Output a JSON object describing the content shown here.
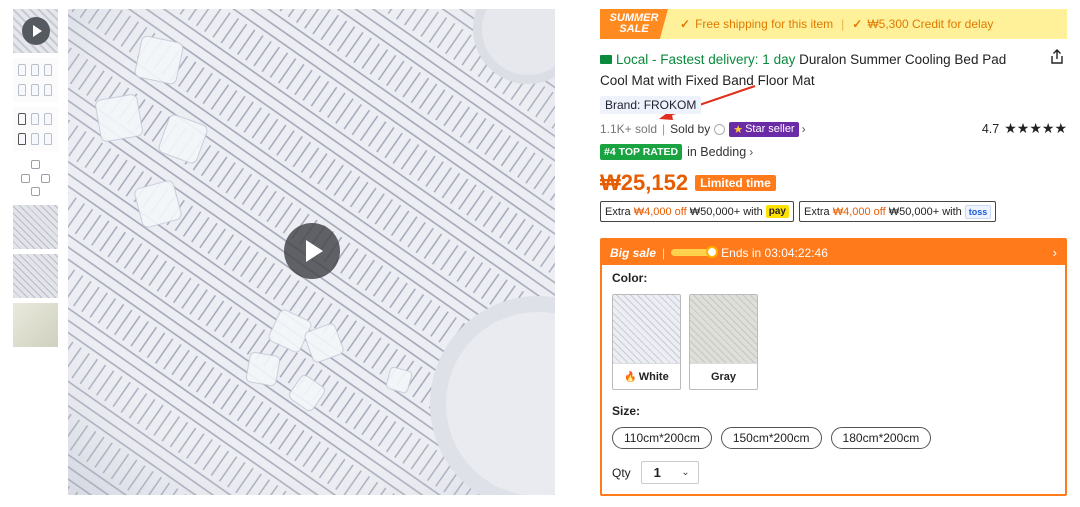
{
  "promo": {
    "badge_line1": "SUMMER",
    "badge_line2": "SALE",
    "free_shipping": "Free shipping for this item",
    "credit": "₩5,300 Credit for delay"
  },
  "product": {
    "delivery": "Local - Fastest delivery: 1 day",
    "title": "Duralon Summer Cooling Bed Pad Cool Mat with Fixed Band Floor Mat",
    "brand": "Brand: FROKOM",
    "sold": "1.1K+ sold",
    "sold_by": "Sold by",
    "star_seller": "Star seller",
    "rating": "4.7",
    "stars": "★★★★★",
    "rank_badge": "#4 TOP RATED",
    "rank_category": "in Bedding",
    "price": "₩25,152",
    "limited": "Limited time"
  },
  "coupons": [
    {
      "prefix": "Extra",
      "off": "₩4,000 off",
      "min": "₩50,000+ with",
      "pay": "pay"
    },
    {
      "prefix": "Extra",
      "off": "₩4,000 off",
      "min": "₩50,000+ with",
      "pay": "toss"
    }
  ],
  "big_sale": {
    "title": "Big sale",
    "ends": "Ends in 03:04:22:46",
    "color_label": "Color:",
    "colors": [
      "White",
      "Gray"
    ],
    "size_label": "Size:",
    "sizes": [
      "110cm*200cm",
      "150cm*200cm",
      "180cm*200cm"
    ],
    "qty_label": "Qty",
    "qty_value": "1"
  },
  "colors": {
    "accent_orange": "#ff7a1a",
    "price_orange": "#e65c00",
    "local_green": "#0a8a3c",
    "star_seller_purple": "#6b2aa6",
    "rank_green": "#1aa341"
  }
}
